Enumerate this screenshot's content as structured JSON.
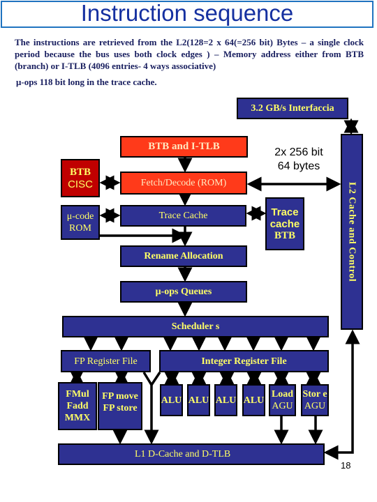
{
  "slide": {
    "title": "Instruction sequence",
    "intro_text": "The instructions are retrieved from the L2(128=2 x 64(=256 bit) Bytes – a single clock period because the bus uses both clock edges ) – Memory address either from BTB (branch) or I-TLB (4096 entries- 4 ways associative)",
    "uops_note": "μ-ops 118 bit long in the trace cache.",
    "page_number": "18"
  },
  "diagram": {
    "interface": "3.2 GB/s Interfaccia",
    "l2_bar": "L2 Cache and Control",
    "bus_label_line1": "2x 256 bit",
    "bus_label_line2": "64 bytes",
    "btb_itlb": "BTB and I-TLB",
    "btb_cisc_line1": "BTB",
    "btb_cisc_line2": "CISC",
    "fetch_decode": "Fetch/Decode (ROM)",
    "ucode_rom_line1": "μ-code",
    "ucode_rom_line2": "ROM",
    "trace_cache": "Trace Cache",
    "trace_cache_btb_line1": "Trace",
    "trace_cache_btb_line2": "cache",
    "trace_cache_btb_line3": "BTB",
    "rename_allocation": "Rename Allocation",
    "uops_queues": "μ-ops Queues",
    "schedulers": "Scheduler s",
    "fp_register_file": "FP Register File",
    "integer_register_file": "Integer Register File",
    "fp_unit1_line1": "FMul",
    "fp_unit1_line2": "Fadd",
    "fp_unit1_line3": "MMX",
    "fp_unit2_line1": "FP move",
    "fp_unit2_line2": "FP store",
    "alu_units": [
      "ALU",
      "ALU",
      "ALU",
      "ALU"
    ],
    "load_agu_line1": "Load",
    "load_agu_line2": "AGU",
    "store_agu_line1": "Stor e",
    "store_agu_line2": "AGU",
    "l1_dcache": "L1 D-Cache and D-TLB"
  },
  "colors": {
    "blue_block": "#2e3192",
    "red_block": "#ff3a1a",
    "dark_red_block": "#c00000",
    "label_yellow": "#ffff66",
    "title_blue": "#1530a0"
  }
}
